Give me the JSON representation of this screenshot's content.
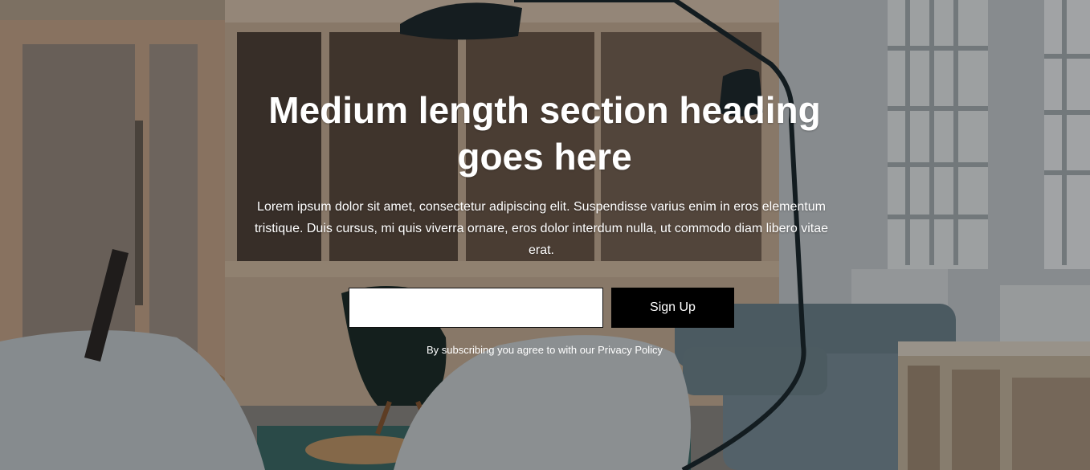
{
  "hero": {
    "heading": "Medium length section heading goes here",
    "description": "Lorem ipsum dolor sit amet, consectetur adipiscing elit. Suspendisse varius enim in eros elementum tristique. Duis cursus, mi quis viverra ornare, eros dolor interdum nulla, ut commodo diam libero vitae erat.",
    "background": "office-lounge-photo"
  },
  "form": {
    "email_value": "",
    "email_placeholder": "",
    "submit_label": "Sign Up"
  },
  "legal": {
    "note": "By subscribing you agree to with our Privacy Policy"
  },
  "colors": {
    "button_bg": "#000000",
    "text": "#ffffff",
    "input_bg": "#ffffff"
  }
}
